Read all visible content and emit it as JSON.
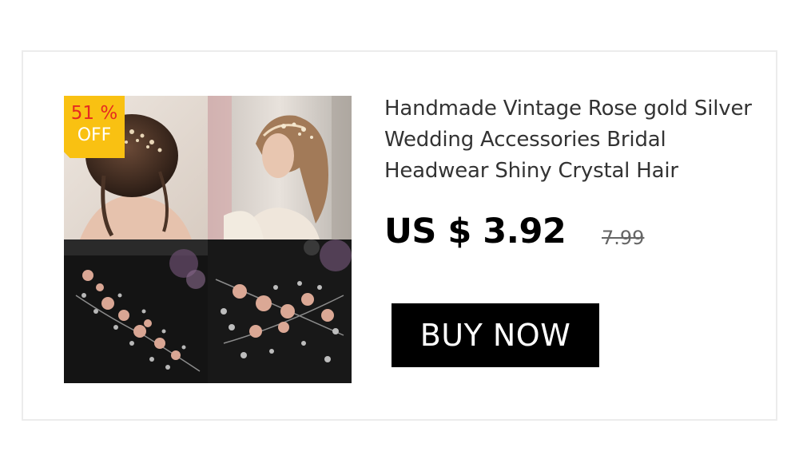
{
  "product": {
    "title": "Handmade Vintage Rose gold Silver Wedding Accessories Bridal Headwear Shiny Crystal Hair",
    "price": "US $ 3.92",
    "original_price": "7.99",
    "discount": {
      "percent_label": "51 %",
      "off_label": "OFF"
    },
    "buy_label": "BUY NOW",
    "images": [
      "bride-hair-back-photo",
      "bride-hair-side-photo",
      "hairpiece-flat-photo",
      "hairpiece-closeup-photo"
    ]
  },
  "colors": {
    "badge": "#f9c112",
    "badge_text": "#e52b20",
    "button": "#000000",
    "button_text": "#ffffff",
    "title_text": "#333333"
  }
}
